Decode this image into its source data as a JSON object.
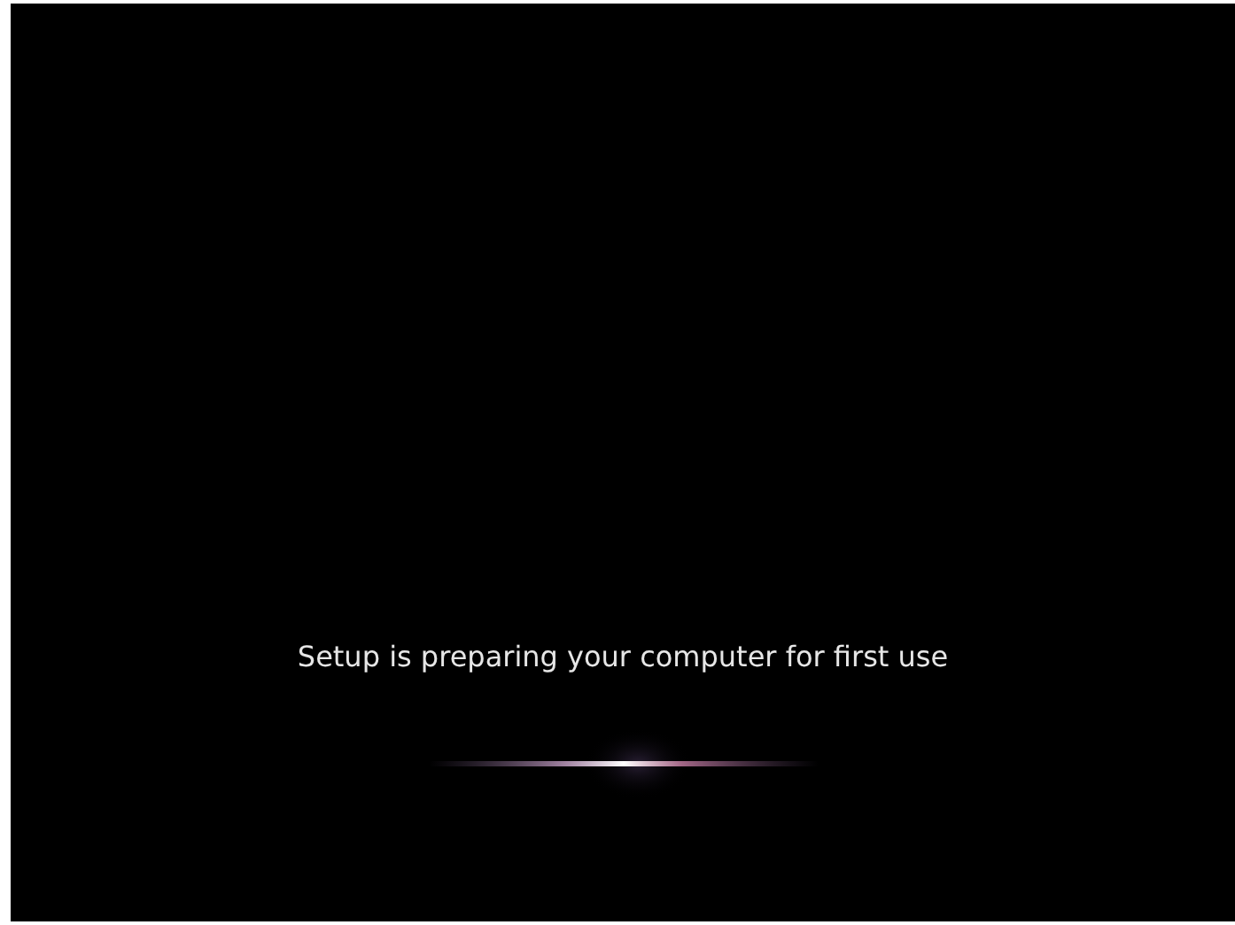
{
  "setup_screen": {
    "message": "Setup is preparing your computer for first use"
  }
}
